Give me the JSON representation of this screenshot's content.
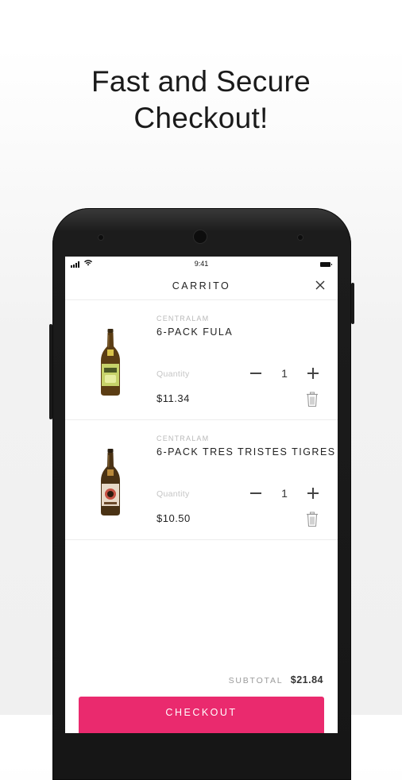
{
  "headline": {
    "line1": "Fast and Secure",
    "line2": "Checkout!"
  },
  "status_bar": {
    "time": "9:41"
  },
  "nav": {
    "title": "CARRITO",
    "close_icon": "close-icon"
  },
  "cart": {
    "items": [
      {
        "brand": "CENTRALAM",
        "name": "6-PACK FULA",
        "quantity_label": "Quantity",
        "quantity": "1",
        "price": "$11.34",
        "label_color": "#c6d26a"
      },
      {
        "brand": "CENTRALAM",
        "name": "6-PACK TRES TRISTES TIGRES",
        "quantity_label": "Quantity",
        "quantity": "1",
        "price": "$10.50",
        "label_color": "#e8d9c7"
      }
    ]
  },
  "footer": {
    "subtotal_label": "SUBTOTAL",
    "subtotal_value": "$21.84",
    "checkout_label": "CHECKOUT"
  },
  "colors": {
    "accent": "#ea2a6e"
  }
}
